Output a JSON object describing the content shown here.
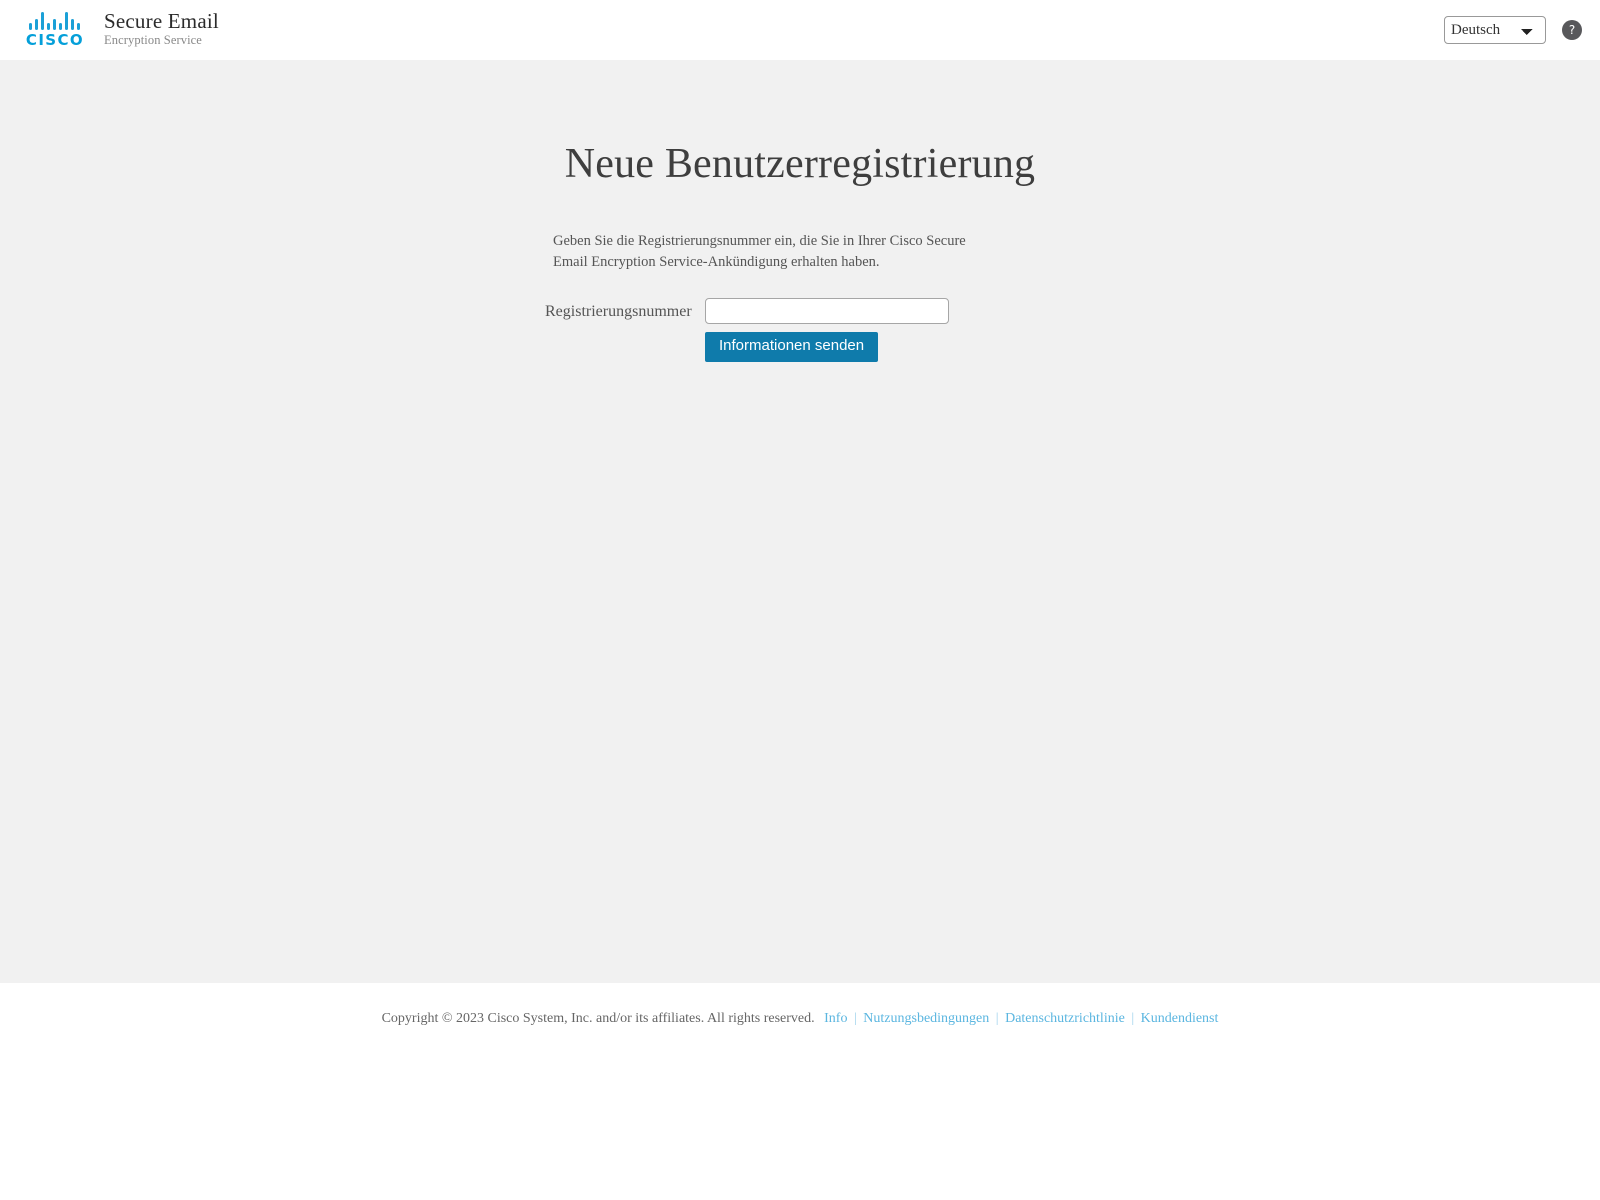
{
  "header": {
    "logo_name": "cisco-logo",
    "brand_color": "#049fd9",
    "wordmark": "CISCO",
    "app_title": "Secure Email",
    "app_subtitle": "Encryption Service",
    "language": {
      "selected": "Deutsch",
      "options": [
        "Deutsch"
      ]
    },
    "help_label": "?"
  },
  "main": {
    "page_title": "Neue Benutzerregistrierung",
    "intro_text": "Geben Sie die Registrierungsnummer ein, die Sie in Ihrer Cisco Secure Email Encryption Service-Ankündigung erhalten haben.",
    "form": {
      "label": "Registrierungsnummer",
      "input_value": "",
      "input_placeholder": "",
      "submit_label": "Informationen senden",
      "submit_color": "#0f7bab"
    }
  },
  "footer": {
    "copyright": "Copyright © 2023 Cisco System, Inc. and/or its affiliates. All rights reserved.",
    "separator": "|",
    "links": [
      {
        "label": "Info"
      },
      {
        "label": "Nutzungsbedingungen"
      },
      {
        "label": "Datenschutzrichtlinie"
      },
      {
        "label": "Kundendienst"
      }
    ],
    "link_color": "#5bb6e0"
  }
}
